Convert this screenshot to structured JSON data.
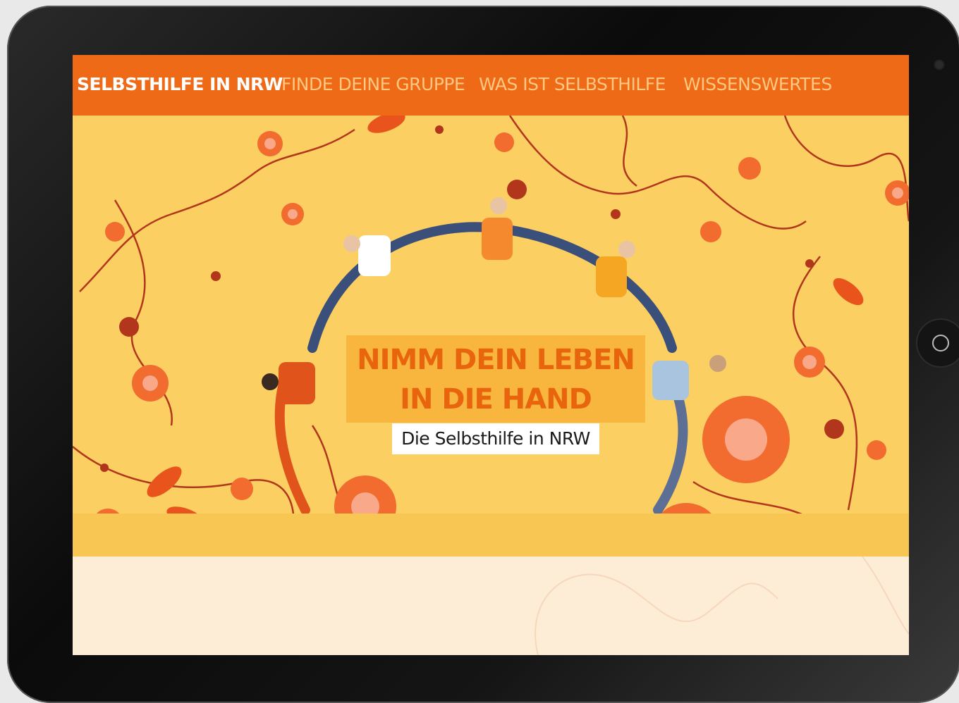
{
  "nav": {
    "brand": "SELBSTHILFE IN NRW",
    "items": [
      {
        "label": "FINDE DEINE GRUPPE"
      },
      {
        "label": "WAS IST SELBSTHILFE"
      },
      {
        "label": "WISSENSWERTES"
      }
    ]
  },
  "hero": {
    "headline_line1": "NIMM DEIN LEBEN",
    "headline_line2": "IN DIE HAND",
    "subtitle": "Die Selbsthilfe in NRW"
  },
  "colors": {
    "nav_bg": "#ee6a17",
    "nav_text": "#ffc77f",
    "hero_bg": "#fbcf62",
    "headline_box": "#f9b63e",
    "headline_text": "#e8650d",
    "flower": "#f26b2f",
    "vine": "#b2361c"
  }
}
